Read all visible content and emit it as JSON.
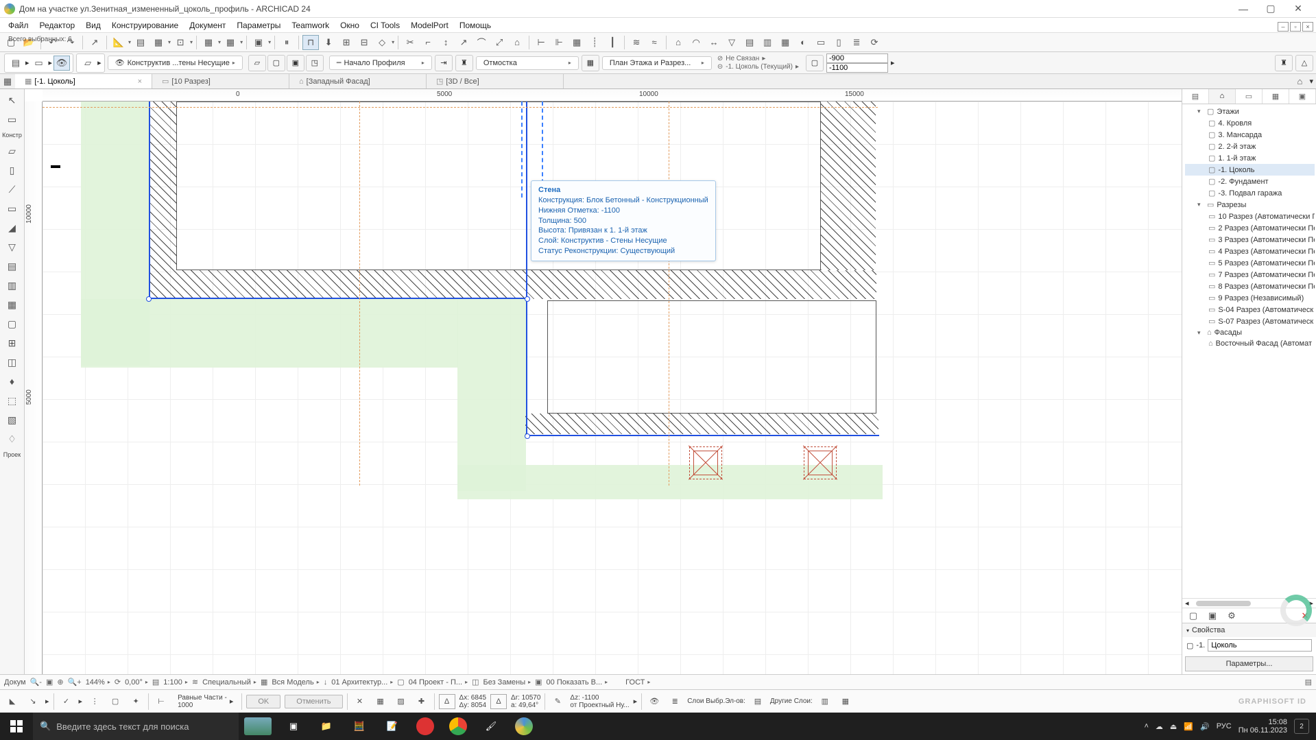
{
  "window": {
    "title": "Дом на участке ул.Зенитная_измененный_цоколь_профиль - ARCHICAD 24"
  },
  "menu": [
    "Файл",
    "Редактор",
    "Вид",
    "Конструирование",
    "Документ",
    "Параметры",
    "Teamwork",
    "Окно",
    "CI Tools",
    "ModelPort",
    "Помощь"
  ],
  "selection_info": "Всего выбранных: 6",
  "info_toolbar": {
    "layer_label": "Конструктив ...тены Несущие",
    "profile_start": "Начало Профиля",
    "zone_label": "Отмостка",
    "view_label": "План Этажа и Разрез...",
    "link_status": "Не Связан",
    "current_story": "-1. Цоколь (Текущий)",
    "coord_x": "-900",
    "coord_y": "-1100"
  },
  "tabs": [
    {
      "icon": "▦",
      "label": "[-1. Цоколь]",
      "active": true,
      "closable": true
    },
    {
      "icon": "▭",
      "label": "[10 Разрез]"
    },
    {
      "icon": "⌂",
      "label": "[Западный Фасад]"
    },
    {
      "icon": "◳",
      "label": "[3D / Все]"
    }
  ],
  "ruler_h": [
    {
      "pos": 282,
      "label": "0"
    },
    {
      "pos": 575,
      "label": "5000"
    },
    {
      "pos": 870,
      "label": "10000"
    },
    {
      "pos": 1170,
      "label": "15000"
    }
  ],
  "ruler_v": [
    {
      "pos": 150,
      "label": "10000"
    },
    {
      "pos": 420,
      "label": "5000"
    }
  ],
  "tooltip": {
    "title": "Стена",
    "line1": "Конструкция: Блок Бетонный - Конструкционный",
    "line2": "Нижняя Отметка: -1100",
    "line3": "Толщина: 500",
    "line4": "Высота: Привязан к 1. 1-й этаж",
    "line5": "Слой: Конструктив - Стены Несущие",
    "line6": "Статус Реконструкции: Существующий"
  },
  "navigator": {
    "groups": {
      "stories": {
        "label": "Этажи",
        "items": [
          "4. Кровля",
          "3. Мансарда",
          "2. 2-й этаж",
          "1. 1-й этаж",
          "-1. Цоколь",
          "-2. Фундамент",
          "-3. Подвал гаража"
        ],
        "selected_index": 4
      },
      "sections": {
        "label": "Разрезы",
        "items": [
          "10 Разрез (Автоматически П",
          "2 Разрез (Автоматически Пе",
          "3 Разрез (Автоматически Пе",
          "4 Разрез (Автоматически Пе",
          "5 Разрез (Автоматически Пе",
          "7 Разрез (Автоматически Пе",
          "8 Разрез (Автоматически Пе",
          "9 Разрез (Независимый)",
          "S-04 Разрез (Автоматическ",
          "S-07 Разрез (Автоматическ"
        ]
      },
      "elevations": {
        "label": "Фасады",
        "items": [
          "Восточный Фасад (Автомат"
        ]
      }
    },
    "properties": {
      "header": "Свойства",
      "prefix": "-1.",
      "name": "Цоколь",
      "params_btn": "Параметры..."
    }
  },
  "status_bottom1": {
    "label_doc": "Докум",
    "zoom": "144%",
    "angle": "0,00°",
    "scale": "1:100",
    "filter": "Специальный",
    "model": "Вся Модель",
    "arch": "01 Архитектур...",
    "proj": "04 Проект - П...",
    "ren": "Без Замены",
    "show": "00 Показать В...",
    "std": "ГОСТ"
  },
  "status_bottom2": {
    "parts_label": "Равные Части -",
    "parts_value": "1000",
    "ok": "OK",
    "cancel": "Отменить",
    "dx": "Δx: 6845",
    "dy": "Δy: 8054",
    "dr": "Δr: 10570",
    "da": "a: 49,64°",
    "dz": "Δz: -1100",
    "origin": "от Проектный Ну...",
    "sel_layers": "Слои Выбр.Эл-ов:",
    "other_layers": "Другие Слои:",
    "gsid": "GRAPHISOFT ID"
  },
  "taskbar": {
    "search_placeholder": "Введите здесь текст для поиска",
    "lang": "РУС",
    "time": "15:08",
    "date": "Пн 06.11.2023",
    "notif_count": "2"
  }
}
